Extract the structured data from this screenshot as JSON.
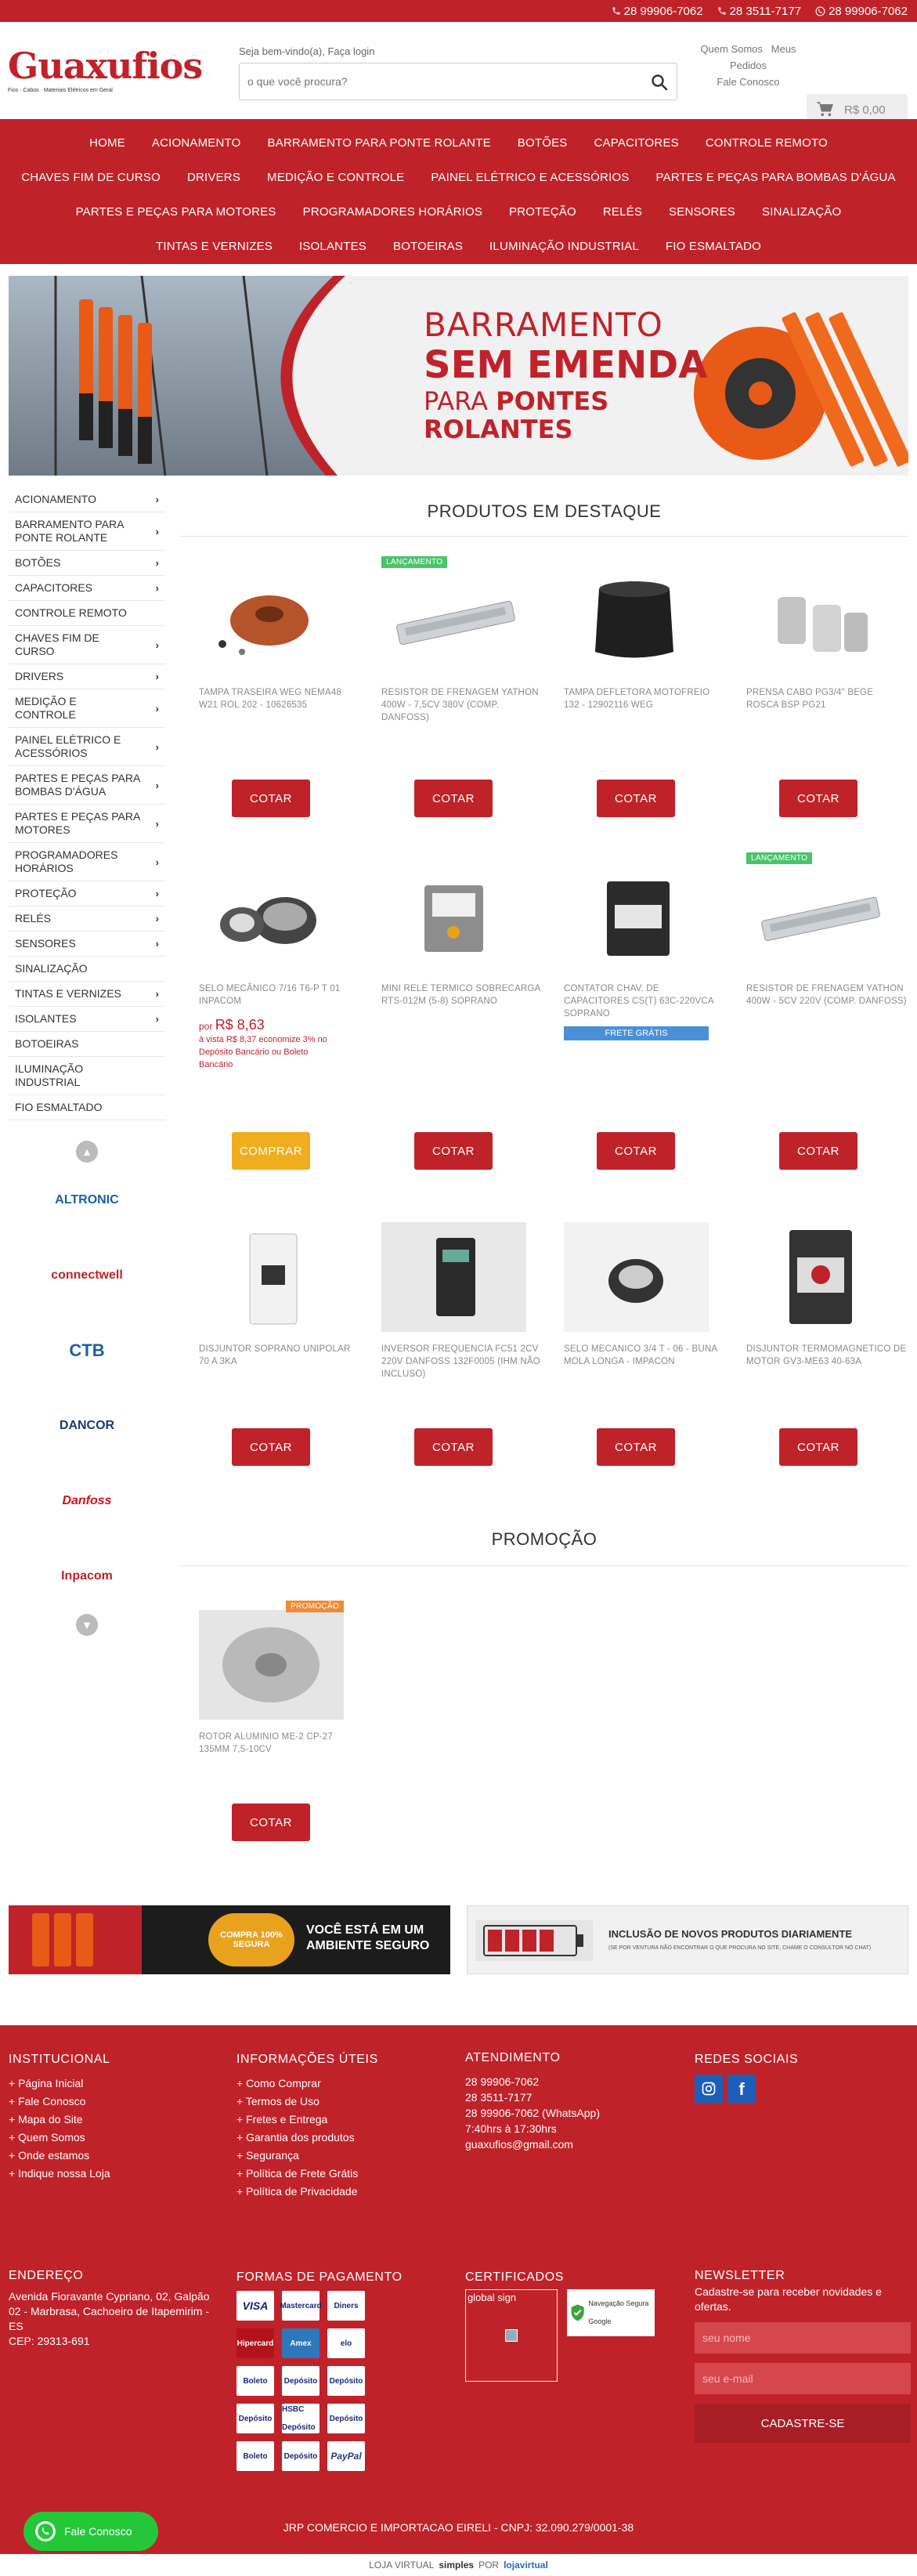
{
  "topbar": {
    "phones": [
      "28 99906-7062",
      "28 3511-7177",
      "28 99906-7062"
    ]
  },
  "header": {
    "logo_text": "Guaxufios",
    "logo_tagline": "Fios · Cabos · Materiais Elétricos em Geral",
    "welcome": "Seja bem-vindo(a), Faça login",
    "search_placeholder": "o que você procura?",
    "links": [
      "Quem Somos",
      "Meus Pedidos",
      "Fale Conosco"
    ],
    "cart_total": "R$ 0,00"
  },
  "nav": {
    "rows": [
      [
        "HOME",
        "ACIONAMENTO",
        "BARRAMENTO PARA PONTE ROLANTE",
        "BOTÕES",
        "CAPACITORES",
        "CONTROLE REMOTO"
      ],
      [
        "CHAVES FIM DE CURSO",
        "DRIVERS",
        "MEDIÇÃO E CONTROLE",
        "PAINEL ELÉTRICO E ACESSÓRIOS",
        "PARTES E PEÇAS PARA BOMBAS D'ÁGUA"
      ],
      [
        "PARTES E PEÇAS PARA MOTORES",
        "PROGRAMADORES HORÁRIOS",
        "PROTEÇÃO",
        "RELÉS",
        "SENSORES",
        "SINALIZAÇÃO"
      ],
      [
        "TINTAS E VERNIZES",
        "ISOLANTES",
        "BOTOEIRAS",
        "ILUMINAÇÃO INDUSTRIAL",
        "FIO ESMALTADO"
      ]
    ]
  },
  "banner": {
    "line1": "BARRAMENTO",
    "line2": "SEM EMENDA",
    "line3a": "PARA",
    "line3b": "PONTES",
    "line4": "ROLANTES"
  },
  "sidebar": {
    "categories": [
      {
        "label": "ACIONAMENTO",
        "arrow": true
      },
      {
        "label": "BARRAMENTO PARA PONTE ROLANTE",
        "arrow": true
      },
      {
        "label": "BOTÕES",
        "arrow": true
      },
      {
        "label": "CAPACITORES",
        "arrow": true
      },
      {
        "label": "CONTROLE REMOTO",
        "arrow": false
      },
      {
        "label": "CHAVES FIM DE CURSO",
        "arrow": true
      },
      {
        "label": "DRIVERS",
        "arrow": true
      },
      {
        "label": "MEDIÇÃO E CONTROLE",
        "arrow": true
      },
      {
        "label": "PAINEL ELÉTRICO E ACESSÓRIOS",
        "arrow": true
      },
      {
        "label": "PARTES E PEÇAS PARA BOMBAS D'ÁGUA",
        "arrow": true
      },
      {
        "label": "PARTES E PEÇAS PARA MOTORES",
        "arrow": true
      },
      {
        "label": "PROGRAMADORES HORÁRIOS",
        "arrow": true
      },
      {
        "label": "PROTEÇÃO",
        "arrow": true
      },
      {
        "label": "RELÉS",
        "arrow": true
      },
      {
        "label": "SENSORES",
        "arrow": true
      },
      {
        "label": "SINALIZAÇÃO",
        "arrow": false
      },
      {
        "label": "TINTAS E VERNIZES",
        "arrow": true
      },
      {
        "label": "ISOLANTES",
        "arrow": true
      },
      {
        "label": "BOTOEIRAS",
        "arrow": false
      },
      {
        "label": "ILUMINAÇÃO INDUSTRIAL",
        "arrow": false
      },
      {
        "label": "FIO ESMALTADO",
        "arrow": false
      }
    ],
    "brands": [
      {
        "name": "ALTRONIC",
        "color": "#1b5fa8"
      },
      {
        "name": "connectwell",
        "color": "#c0222a"
      },
      {
        "name": "CTB",
        "color": "#1b5fa8"
      },
      {
        "name": "DANCOR",
        "color": "#1b3a7a"
      },
      {
        "name": "Danfoss",
        "color": "#d0141c"
      },
      {
        "name": "Inpacom",
        "color": "#c0222a"
      }
    ]
  },
  "featured": {
    "title": "PRODUTOS EM DESTAQUE",
    "products": [
      {
        "name": "TAMPA TRASEIRA WEG NEMA48 W21 ROL 202 - 10626535",
        "button": "COTAR"
      },
      {
        "name": "RESISTOR DE FRENAGEM YATHON 400W - 7,5CV 380V (COMP. DANFOSS)",
        "button": "COTAR",
        "badge": "LANÇAMENTO"
      },
      {
        "name": "TAMPA DEFLETORA MOTOFREIO 132 - 12902116 WEG",
        "button": "COTAR"
      },
      {
        "name": "PRENSA CABO PG3/4\" BEGE ROSCA BSP PG21",
        "button": "COTAR"
      },
      {
        "name": "SELO MECÂNICO 7/16 T6-P T 01 INPACOM",
        "button": "COMPRAR",
        "price_prefix": "por",
        "price": "R$ 8,63",
        "price_note": "à vista R$ 8,37 economize 3% no Depósito Bancário ou Boleto Bancário"
      },
      {
        "name": "MINI RELE TERMICO SOBRECARGA RTS-012M (5-8) SOPRANO",
        "button": "COTAR"
      },
      {
        "name": "CONTATOR CHAV. DE CAPACITORES CS(T) 63C-220VCA SOPRANO",
        "button": "COTAR",
        "tag": "FRETE GRÁTIS"
      },
      {
        "name": "RESISTOR DE FRENAGEM YATHON 400W - 5CV 220V (COMP. DANFOSS)",
        "button": "COTAR",
        "badge": "LANÇAMENTO"
      },
      {
        "name": "DISJUNTOR SOPRANO UNIPOLAR 70 A 3KA",
        "button": "COTAR"
      },
      {
        "name": "INVERSOR FREQUENCIA FC51 2CV 220V DANFOSS 132F0005 (IHM NÃO INCLUSO)",
        "button": "COTAR"
      },
      {
        "name": "SELO MECANICO 3/4 T - 06 - BUNA MOLA LONGA - IMPACON",
        "button": "COTAR"
      },
      {
        "name": "DISJUNTOR TERMOMAGNETICO DE MOTOR GV3-ME63 40-63A",
        "button": "COTAR"
      }
    ]
  },
  "promo": {
    "title": "PROMOÇÃO",
    "products": [
      {
        "name": "ROTOR ALUMINIO ME-2 CP-27 135MM 7,5-10CV",
        "button": "COTAR",
        "badge": "PROMOÇÃO"
      }
    ]
  },
  "security_banners": {
    "left_seal": "COMPRA 100% SEGURA",
    "left_text": "VOCÊ ESTÁ EM UM AMBIENTE SEGURO",
    "right_title": "INCLUSÃO DE NOVOS PRODUTOS DIARIAMENTE",
    "right_sub": "(SE POR VENTURA NÃO ENCONTRAR O QUE PROCURA NO SITE, CHAME O CONSULTOR NO CHAT)"
  },
  "footer": {
    "institucional": {
      "title": "INSTITUCIONAL",
      "links": [
        "+ Página Inicial",
        "+ Fale Conosco",
        "+ Mapa do Site",
        "+ Quem Somos",
        "+ Onde estamos",
        "+ Indique nossa Loja"
      ]
    },
    "info": {
      "title": "INFORMAÇÕES ÚTEIS",
      "links": [
        "+ Como Comprar",
        "+ Termos de Uso",
        "+ Fretes e Entrega",
        "+ Garantia dos produtos",
        "+ Segurança",
        "+ Política de Frete Grátis",
        "+ Política de Privacidade"
      ]
    },
    "atendimento": {
      "title": "ATENDIMENTO",
      "lines": [
        "28 99906-7062",
        "28 3511-7177",
        "28 99906-7062 (WhatsApp)",
        "7:40hrs à 17:30hrs",
        "guaxufios@gmail.com"
      ]
    },
    "social": {
      "title": "REDES SOCIAIS"
    },
    "endereco": {
      "title": "ENDEREÇO",
      "text": "Avenida Fioravante Cypriano, 02, Galpão 02 - Marbrasa, Cachoeiro de Itapemirim - ES",
      "cep": "CEP: 29313-691"
    },
    "pagamento": {
      "title": "FORMAS DE PAGAMENTO",
      "methods": [
        "VISA",
        "Mastercard",
        "Diners",
        "Hipercard",
        "Amex",
        "elo",
        "Boleto",
        "Depósito",
        "Depósito",
        "Depósito",
        "HSBC Depósito",
        "Depósito",
        "Boleto",
        "Depósito",
        "PayPal"
      ]
    },
    "certificados": {
      "title": "CERTIFICADOS",
      "global": "global sign",
      "google": "Navegação Segura Google"
    },
    "newsletter": {
      "title": "NEWSLETTER",
      "text": "Cadastre-se para receber novidades e ofertas.",
      "name_placeholder": "seu nome",
      "email_placeholder": "seu e-mail",
      "button": "CADASTRE-SE"
    },
    "copyright": "JRP COMERCIO E IMPORTACAO EIRELI  -  CNPJ: 32.090.279/0001-38"
  },
  "whatsapp": {
    "label": "Fale Conosco"
  },
  "bottombar": {
    "text": "LOJA VIRTUAL",
    "brand1": "simples",
    "by": "POR",
    "brand2": "lojavirtual"
  },
  "colors": {
    "primary": "#c0222a",
    "buy": "#f0ad1e",
    "launch": "#4cc36b",
    "promo": "#ef8b35",
    "frete": "#4a90d9"
  }
}
